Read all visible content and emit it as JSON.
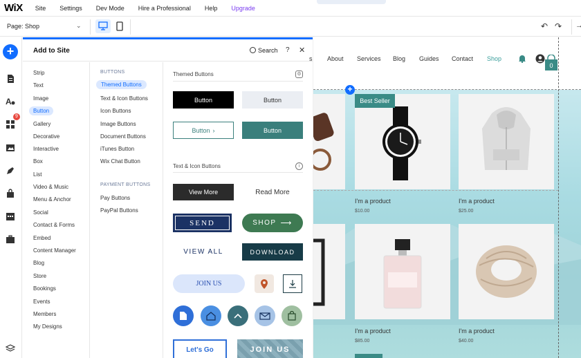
{
  "topbar": {
    "logo": "WiX",
    "menu": [
      "Site",
      "Settings",
      "Dev Mode",
      "Hire a Professional",
      "Help",
      "Upgrade"
    ]
  },
  "secondbar": {
    "page_label": "Page: Shop"
  },
  "rail": {
    "badge": "9"
  },
  "panel": {
    "title": "Add to Site",
    "search_label": "Search",
    "help": "?",
    "close": "✕",
    "categories": [
      "Strip",
      "Text",
      "Image",
      "Button",
      "Gallery",
      "Decorative",
      "Interactive",
      "Box",
      "List",
      "Video & Music",
      "Menu & Anchor",
      "Social",
      "Contact & Forms",
      "Embed",
      "Content Manager",
      "Blog",
      "Store",
      "Bookings",
      "Events",
      "Members",
      "My Designs"
    ],
    "active_category": "Button",
    "sub_heading_1": "BUTTONS",
    "subcategories_1": [
      "Themed Buttons",
      "Text & Icon Buttons",
      "Icon Buttons",
      "Image Buttons",
      "Document Buttons",
      "iTunes Button",
      "Wix Chat Button"
    ],
    "active_subcategory": "Themed Buttons",
    "sub_heading_2": "PAYMENT BUTTONS",
    "subcategories_2": [
      "Pay Buttons",
      "PayPal Buttons"
    ],
    "section_themed": "Themed Buttons",
    "section_text_icon": "Text & Icon Buttons",
    "btn_label": "Button",
    "btn_view_more": "View More",
    "btn_read_more": "Read More",
    "btn_send": "SEND",
    "btn_shop": "SHOP",
    "btn_view_all": "VIEW ALL",
    "btn_download": "DOWNLOAD",
    "btn_join_us": "JOIN US",
    "btn_lets_go": "Let's Go",
    "btn_join_us_2": "JOIN US"
  },
  "site": {
    "nav": [
      "About",
      "Services",
      "Blog",
      "Guides",
      "Contact",
      "Shop"
    ],
    "active_nav": "Shop",
    "cart_count": "0",
    "best_seller": "Best Seller",
    "products": [
      {
        "name": "I'm a product",
        "price": "$10.00"
      },
      {
        "name": "I'm a product",
        "price": "$25.00"
      },
      {
        "name": "I'm a product",
        "price": "$85.00"
      },
      {
        "name": "I'm a product",
        "price": "$40.00"
      }
    ]
  },
  "colors": {
    "accent": "#116dff",
    "teal": "#3a7f7c",
    "site_accent": "#3a9e9b",
    "upgrade": "#7a3cf0"
  }
}
